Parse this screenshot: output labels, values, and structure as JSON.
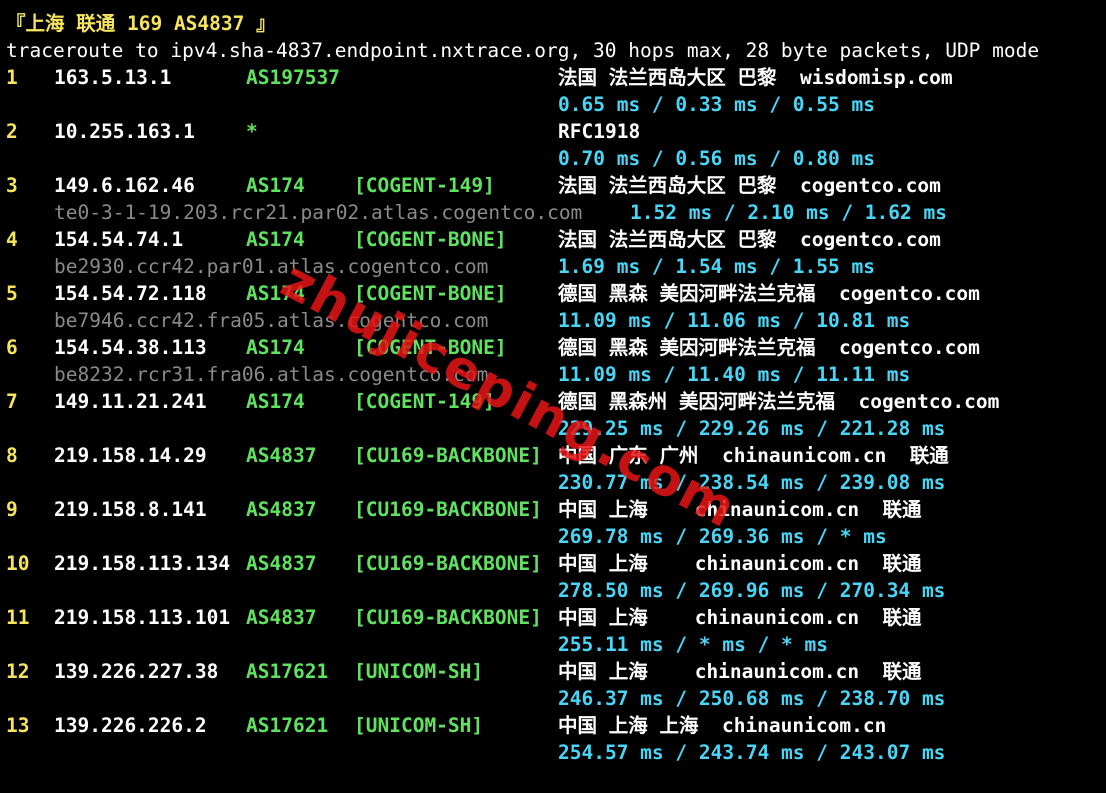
{
  "header": {
    "title": "『上海 联通 169 AS4837 』",
    "command": "traceroute to ipv4.sha-4837.endpoint.nxtrace.org, 30 hops max, 28 byte packets, UDP mode"
  },
  "hops": [
    {
      "hop": "1",
      "ip": "163.5.13.1",
      "asn": "AS197537",
      "tag": "",
      "geo": "法国 法兰西岛大区 巴黎  wisdomisp.com",
      "host": "",
      "rtt": "0.65 ms / 0.33 ms / 0.55 ms"
    },
    {
      "hop": "2",
      "ip": "10.255.163.1",
      "asn": "*",
      "tag": "",
      "geo": "RFC1918",
      "host": "",
      "rtt": "0.70 ms / 0.56 ms / 0.80 ms"
    },
    {
      "hop": "3",
      "ip": "149.6.162.46",
      "asn": "AS174",
      "tag": "[COGENT-149]",
      "geo": "法国 法兰西岛大区 巴黎  cogentco.com",
      "host": "te0-3-1-19.203.rcr21.par02.atlas.cogentco.com",
      "rtt": "1.52 ms / 2.10 ms / 1.62 ms"
    },
    {
      "hop": "4",
      "ip": "154.54.74.1",
      "asn": "AS174",
      "tag": "[COGENT-BONE]",
      "geo": "法国 法兰西岛大区 巴黎  cogentco.com",
      "host": "be2930.ccr42.par01.atlas.cogentco.com",
      "rtt": "1.69 ms / 1.54 ms / 1.55 ms"
    },
    {
      "hop": "5",
      "ip": "154.54.72.118",
      "asn": "AS174",
      "tag": "[COGENT-BONE]",
      "geo": "德国 黑森 美因河畔法兰克福  cogentco.com",
      "host": "be7946.ccr42.fra05.atlas.cogentco.com",
      "rtt": "11.09 ms / 11.06 ms / 10.81 ms"
    },
    {
      "hop": "6",
      "ip": "154.54.38.113",
      "asn": "AS174",
      "tag": "[COGENT-BONE]",
      "geo": "德国 黑森 美因河畔法兰克福  cogentco.com",
      "host": "be8232.rcr31.fra06.atlas.cogentco.com",
      "rtt": "11.09 ms / 11.40 ms / 11.11 ms"
    },
    {
      "hop": "7",
      "ip": "149.11.21.241",
      "asn": "AS174",
      "tag": "[COGENT-149]",
      "geo": "德国 黑森州 美因河畔法兰克福  cogentco.com",
      "host": "",
      "rtt": "229.25 ms / 229.26 ms / 221.28 ms"
    },
    {
      "hop": "8",
      "ip": "219.158.14.29",
      "asn": "AS4837",
      "tag": "[CU169-BACKBONE]",
      "geo": "中国 广东 广州  chinaunicom.cn  联通",
      "host": "",
      "rtt": "230.77 ms / 238.54 ms / 239.08 ms"
    },
    {
      "hop": "9",
      "ip": "219.158.8.141",
      "asn": "AS4837",
      "tag": "[CU169-BACKBONE]",
      "geo": "中国 上海    chinaunicom.cn  联通",
      "host": "",
      "rtt": "269.78 ms / 269.36 ms / * ms"
    },
    {
      "hop": "10",
      "ip": "219.158.113.134",
      "asn": "AS4837",
      "tag": "[CU169-BACKBONE]",
      "geo": "中国 上海    chinaunicom.cn  联通",
      "host": "",
      "rtt": "278.50 ms / 269.96 ms / 270.34 ms"
    },
    {
      "hop": "11",
      "ip": "219.158.113.101",
      "asn": "AS4837",
      "tag": "[CU169-BACKBONE]",
      "geo": "中国 上海    chinaunicom.cn  联通",
      "host": "",
      "rtt": "255.11 ms / * ms / * ms"
    },
    {
      "hop": "12",
      "ip": "139.226.227.38",
      "asn": "AS17621",
      "tag": "[UNICOM-SH]",
      "geo": "中国 上海    chinaunicom.cn  联通",
      "host": "",
      "rtt": "246.37 ms / 250.68 ms / 238.70 ms"
    },
    {
      "hop": "13",
      "ip": "139.226.226.2",
      "asn": "AS17621",
      "tag": "[UNICOM-SH]",
      "geo": "中国 上海 上海  chinaunicom.cn",
      "host": "",
      "rtt": "254.57 ms / 243.74 ms / 243.07 ms"
    }
  ],
  "watermark": "zhujiceping.com",
  "colors": {
    "background": "#000000",
    "title": "#f6e55c",
    "hop_number": "#f6e55c",
    "asn": "#5fe25f",
    "rtt": "#49d6f6",
    "hostname": "#8a8a8a",
    "watermark": "#e61414"
  }
}
